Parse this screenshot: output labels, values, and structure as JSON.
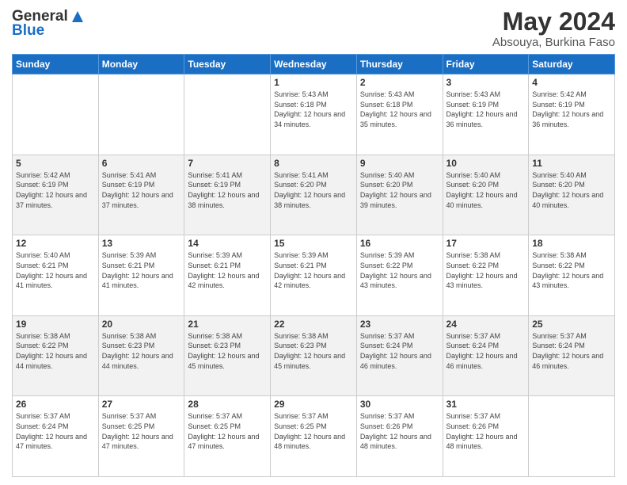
{
  "logo": {
    "text_general": "General",
    "text_blue": "Blue"
  },
  "header": {
    "title": "May 2024",
    "subtitle": "Absouya, Burkina Faso"
  },
  "weekdays": [
    "Sunday",
    "Monday",
    "Tuesday",
    "Wednesday",
    "Thursday",
    "Friday",
    "Saturday"
  ],
  "weeks": [
    [
      {
        "day": "",
        "sunrise": "",
        "sunset": "",
        "daylight": ""
      },
      {
        "day": "",
        "sunrise": "",
        "sunset": "",
        "daylight": ""
      },
      {
        "day": "",
        "sunrise": "",
        "sunset": "",
        "daylight": ""
      },
      {
        "day": "1",
        "sunrise": "Sunrise: 5:43 AM",
        "sunset": "Sunset: 6:18 PM",
        "daylight": "Daylight: 12 hours and 34 minutes."
      },
      {
        "day": "2",
        "sunrise": "Sunrise: 5:43 AM",
        "sunset": "Sunset: 6:18 PM",
        "daylight": "Daylight: 12 hours and 35 minutes."
      },
      {
        "day": "3",
        "sunrise": "Sunrise: 5:43 AM",
        "sunset": "Sunset: 6:19 PM",
        "daylight": "Daylight: 12 hours and 36 minutes."
      },
      {
        "day": "4",
        "sunrise": "Sunrise: 5:42 AM",
        "sunset": "Sunset: 6:19 PM",
        "daylight": "Daylight: 12 hours and 36 minutes."
      }
    ],
    [
      {
        "day": "5",
        "sunrise": "Sunrise: 5:42 AM",
        "sunset": "Sunset: 6:19 PM",
        "daylight": "Daylight: 12 hours and 37 minutes."
      },
      {
        "day": "6",
        "sunrise": "Sunrise: 5:41 AM",
        "sunset": "Sunset: 6:19 PM",
        "daylight": "Daylight: 12 hours and 37 minutes."
      },
      {
        "day": "7",
        "sunrise": "Sunrise: 5:41 AM",
        "sunset": "Sunset: 6:19 PM",
        "daylight": "Daylight: 12 hours and 38 minutes."
      },
      {
        "day": "8",
        "sunrise": "Sunrise: 5:41 AM",
        "sunset": "Sunset: 6:20 PM",
        "daylight": "Daylight: 12 hours and 38 minutes."
      },
      {
        "day": "9",
        "sunrise": "Sunrise: 5:40 AM",
        "sunset": "Sunset: 6:20 PM",
        "daylight": "Daylight: 12 hours and 39 minutes."
      },
      {
        "day": "10",
        "sunrise": "Sunrise: 5:40 AM",
        "sunset": "Sunset: 6:20 PM",
        "daylight": "Daylight: 12 hours and 40 minutes."
      },
      {
        "day": "11",
        "sunrise": "Sunrise: 5:40 AM",
        "sunset": "Sunset: 6:20 PM",
        "daylight": "Daylight: 12 hours and 40 minutes."
      }
    ],
    [
      {
        "day": "12",
        "sunrise": "Sunrise: 5:40 AM",
        "sunset": "Sunset: 6:21 PM",
        "daylight": "Daylight: 12 hours and 41 minutes."
      },
      {
        "day": "13",
        "sunrise": "Sunrise: 5:39 AM",
        "sunset": "Sunset: 6:21 PM",
        "daylight": "Daylight: 12 hours and 41 minutes."
      },
      {
        "day": "14",
        "sunrise": "Sunrise: 5:39 AM",
        "sunset": "Sunset: 6:21 PM",
        "daylight": "Daylight: 12 hours and 42 minutes."
      },
      {
        "day": "15",
        "sunrise": "Sunrise: 5:39 AM",
        "sunset": "Sunset: 6:21 PM",
        "daylight": "Daylight: 12 hours and 42 minutes."
      },
      {
        "day": "16",
        "sunrise": "Sunrise: 5:39 AM",
        "sunset": "Sunset: 6:22 PM",
        "daylight": "Daylight: 12 hours and 43 minutes."
      },
      {
        "day": "17",
        "sunrise": "Sunrise: 5:38 AM",
        "sunset": "Sunset: 6:22 PM",
        "daylight": "Daylight: 12 hours and 43 minutes."
      },
      {
        "day": "18",
        "sunrise": "Sunrise: 5:38 AM",
        "sunset": "Sunset: 6:22 PM",
        "daylight": "Daylight: 12 hours and 43 minutes."
      }
    ],
    [
      {
        "day": "19",
        "sunrise": "Sunrise: 5:38 AM",
        "sunset": "Sunset: 6:22 PM",
        "daylight": "Daylight: 12 hours and 44 minutes."
      },
      {
        "day": "20",
        "sunrise": "Sunrise: 5:38 AM",
        "sunset": "Sunset: 6:23 PM",
        "daylight": "Daylight: 12 hours and 44 minutes."
      },
      {
        "day": "21",
        "sunrise": "Sunrise: 5:38 AM",
        "sunset": "Sunset: 6:23 PM",
        "daylight": "Daylight: 12 hours and 45 minutes."
      },
      {
        "day": "22",
        "sunrise": "Sunrise: 5:38 AM",
        "sunset": "Sunset: 6:23 PM",
        "daylight": "Daylight: 12 hours and 45 minutes."
      },
      {
        "day": "23",
        "sunrise": "Sunrise: 5:37 AM",
        "sunset": "Sunset: 6:24 PM",
        "daylight": "Daylight: 12 hours and 46 minutes."
      },
      {
        "day": "24",
        "sunrise": "Sunrise: 5:37 AM",
        "sunset": "Sunset: 6:24 PM",
        "daylight": "Daylight: 12 hours and 46 minutes."
      },
      {
        "day": "25",
        "sunrise": "Sunrise: 5:37 AM",
        "sunset": "Sunset: 6:24 PM",
        "daylight": "Daylight: 12 hours and 46 minutes."
      }
    ],
    [
      {
        "day": "26",
        "sunrise": "Sunrise: 5:37 AM",
        "sunset": "Sunset: 6:24 PM",
        "daylight": "Daylight: 12 hours and 47 minutes."
      },
      {
        "day": "27",
        "sunrise": "Sunrise: 5:37 AM",
        "sunset": "Sunset: 6:25 PM",
        "daylight": "Daylight: 12 hours and 47 minutes."
      },
      {
        "day": "28",
        "sunrise": "Sunrise: 5:37 AM",
        "sunset": "Sunset: 6:25 PM",
        "daylight": "Daylight: 12 hours and 47 minutes."
      },
      {
        "day": "29",
        "sunrise": "Sunrise: 5:37 AM",
        "sunset": "Sunset: 6:25 PM",
        "daylight": "Daylight: 12 hours and 48 minutes."
      },
      {
        "day": "30",
        "sunrise": "Sunrise: 5:37 AM",
        "sunset": "Sunset: 6:26 PM",
        "daylight": "Daylight: 12 hours and 48 minutes."
      },
      {
        "day": "31",
        "sunrise": "Sunrise: 5:37 AM",
        "sunset": "Sunset: 6:26 PM",
        "daylight": "Daylight: 12 hours and 48 minutes."
      },
      {
        "day": "",
        "sunrise": "",
        "sunset": "",
        "daylight": ""
      }
    ]
  ]
}
